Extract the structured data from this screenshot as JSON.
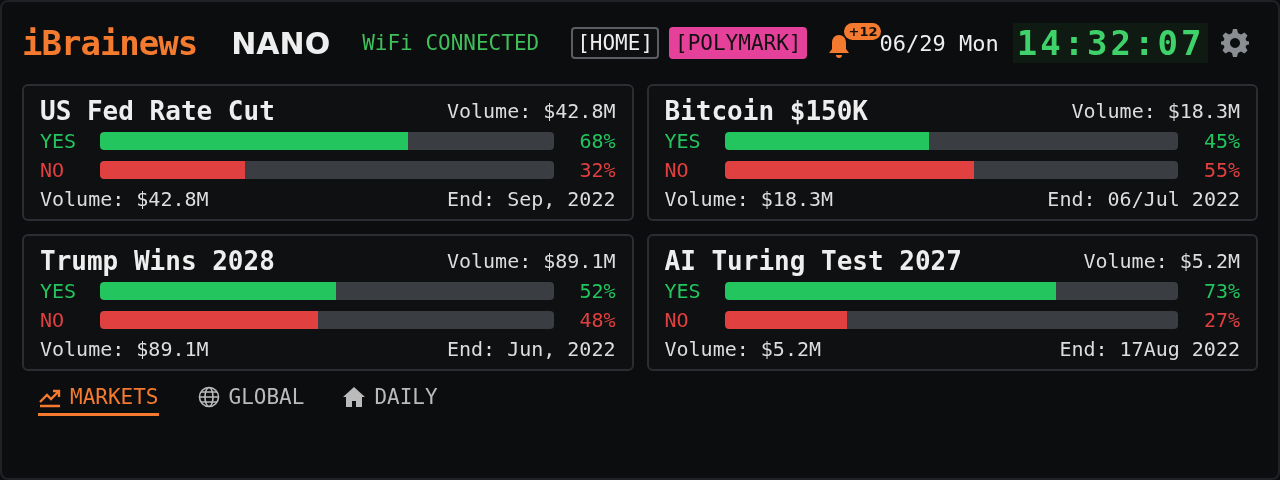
{
  "header": {
    "brand": "iBrainews",
    "model": "NANO",
    "status": "WiFi CONNECTED",
    "sources": [
      {
        "label": "[HOME]",
        "selected": false
      },
      {
        "label": "[POLYMARK]",
        "selected": true
      }
    ],
    "notifications": "+12",
    "date": "06/29 Mon",
    "clock": "14:32:07"
  },
  "markets": [
    {
      "title": "US Fed Rate Cut",
      "volume_top": "Volume: $42.8M",
      "outcomes": [
        {
          "kind": "yes",
          "label": "YES",
          "level": 0.68,
          "reading": "68%"
        },
        {
          "kind": "no",
          "label": "NO",
          "level": 0.32,
          "reading": "32%"
        }
      ],
      "volume": "Volume: $42.8M",
      "end": "End: Sep, 2022"
    },
    {
      "title": "Bitcoin $150K",
      "volume_top": "Volume: $18.3M",
      "outcomes": [
        {
          "kind": "yes",
          "label": "YES",
          "level": 0.45,
          "reading": "45%"
        },
        {
          "kind": "no",
          "label": "NO",
          "level": 0.55,
          "reading": "55%"
        }
      ],
      "volume": "Volume: $18.3M",
      "end": "End: 06/Jul 2022"
    },
    {
      "title": "Trump Wins 2028",
      "volume_top": "Volume: $89.1M",
      "outcomes": [
        {
          "kind": "yes",
          "label": "YES",
          "level": 0.52,
          "reading": "52%"
        },
        {
          "kind": "no",
          "label": "NO",
          "level": 0.48,
          "reading": "48%"
        }
      ],
      "volume": "Volume: $89.1M",
      "end": "End: Jun, 2022"
    },
    {
      "title": "AI Turing Test 2027",
      "volume_top": "Volume: $5.2M",
      "outcomes": [
        {
          "kind": "yes",
          "label": "YES",
          "level": 0.73,
          "reading": "73%"
        },
        {
          "kind": "no",
          "label": "NO",
          "level": 0.27,
          "reading": "27%"
        }
      ],
      "volume": "Volume: $5.2M",
      "end": "End: 17Aug 2022"
    }
  ],
  "nav": [
    {
      "kind": "chart",
      "label": "MARKETS",
      "selected": true
    },
    {
      "kind": "globe",
      "label": "GLOBAL",
      "selected": false
    },
    {
      "kind": "home",
      "label": "DAILY",
      "selected": false
    }
  ]
}
